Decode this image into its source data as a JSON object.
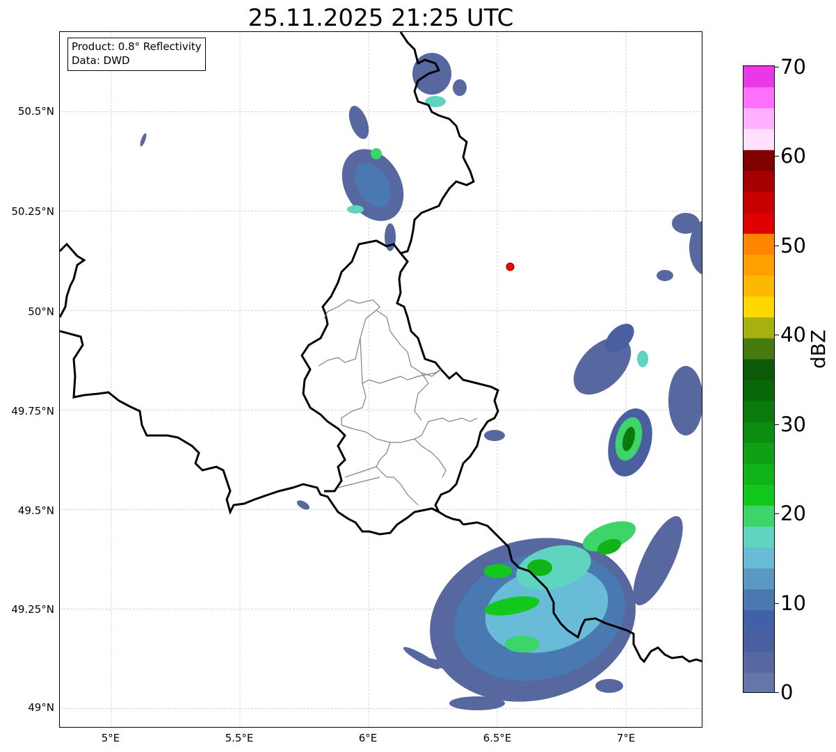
{
  "title": "25.11.2025 21:25 UTC",
  "info": {
    "product": "Product: 0.8° Reflectivity",
    "data": "Data: DWD"
  },
  "axes": {
    "lat_labels": [
      "50.5°N",
      "50.25°N",
      "50°N",
      "49.75°N",
      "49.5°N",
      "49.25°N",
      "49°N"
    ],
    "lon_labels": [
      "5°E",
      "5.5°E",
      "6°E",
      "6.5°E",
      "7°E"
    ],
    "lat_range": [
      48.95,
      50.7
    ],
    "lon_range": [
      4.8,
      7.3
    ],
    "grid": true
  },
  "marker": {
    "lat": 50.11,
    "lon": 6.55,
    "color": "#ff0000"
  },
  "colorbar": {
    "label": "dBZ",
    "ticks": [
      "70",
      "60",
      "50",
      "40",
      "30",
      "20",
      "10",
      "0"
    ],
    "range": [
      0,
      70
    ],
    "colors": [
      "#6577aa",
      "#56689f",
      "#4a5fa0",
      "#4060a8",
      "#4a78b0",
      "#5a98c4",
      "#68bcd8",
      "#5fd5c0",
      "#3dd46a",
      "#13c81c",
      "#10b418",
      "#10a014",
      "#0c8c10",
      "#0a7a0c",
      "#076808",
      "#0a5a08",
      "#467a0c",
      "#a6b010",
      "#ffd800",
      "#ffb800",
      "#ffa000",
      "#ff8400",
      "#e00000",
      "#c80000",
      "#a80000",
      "#800000",
      "#ffe0ff",
      "#ffb0ff",
      "#ff70ff",
      "#e838e8"
    ]
  },
  "legend_items": {
    "borders": "country borders",
    "districts": "district boundaries"
  }
}
